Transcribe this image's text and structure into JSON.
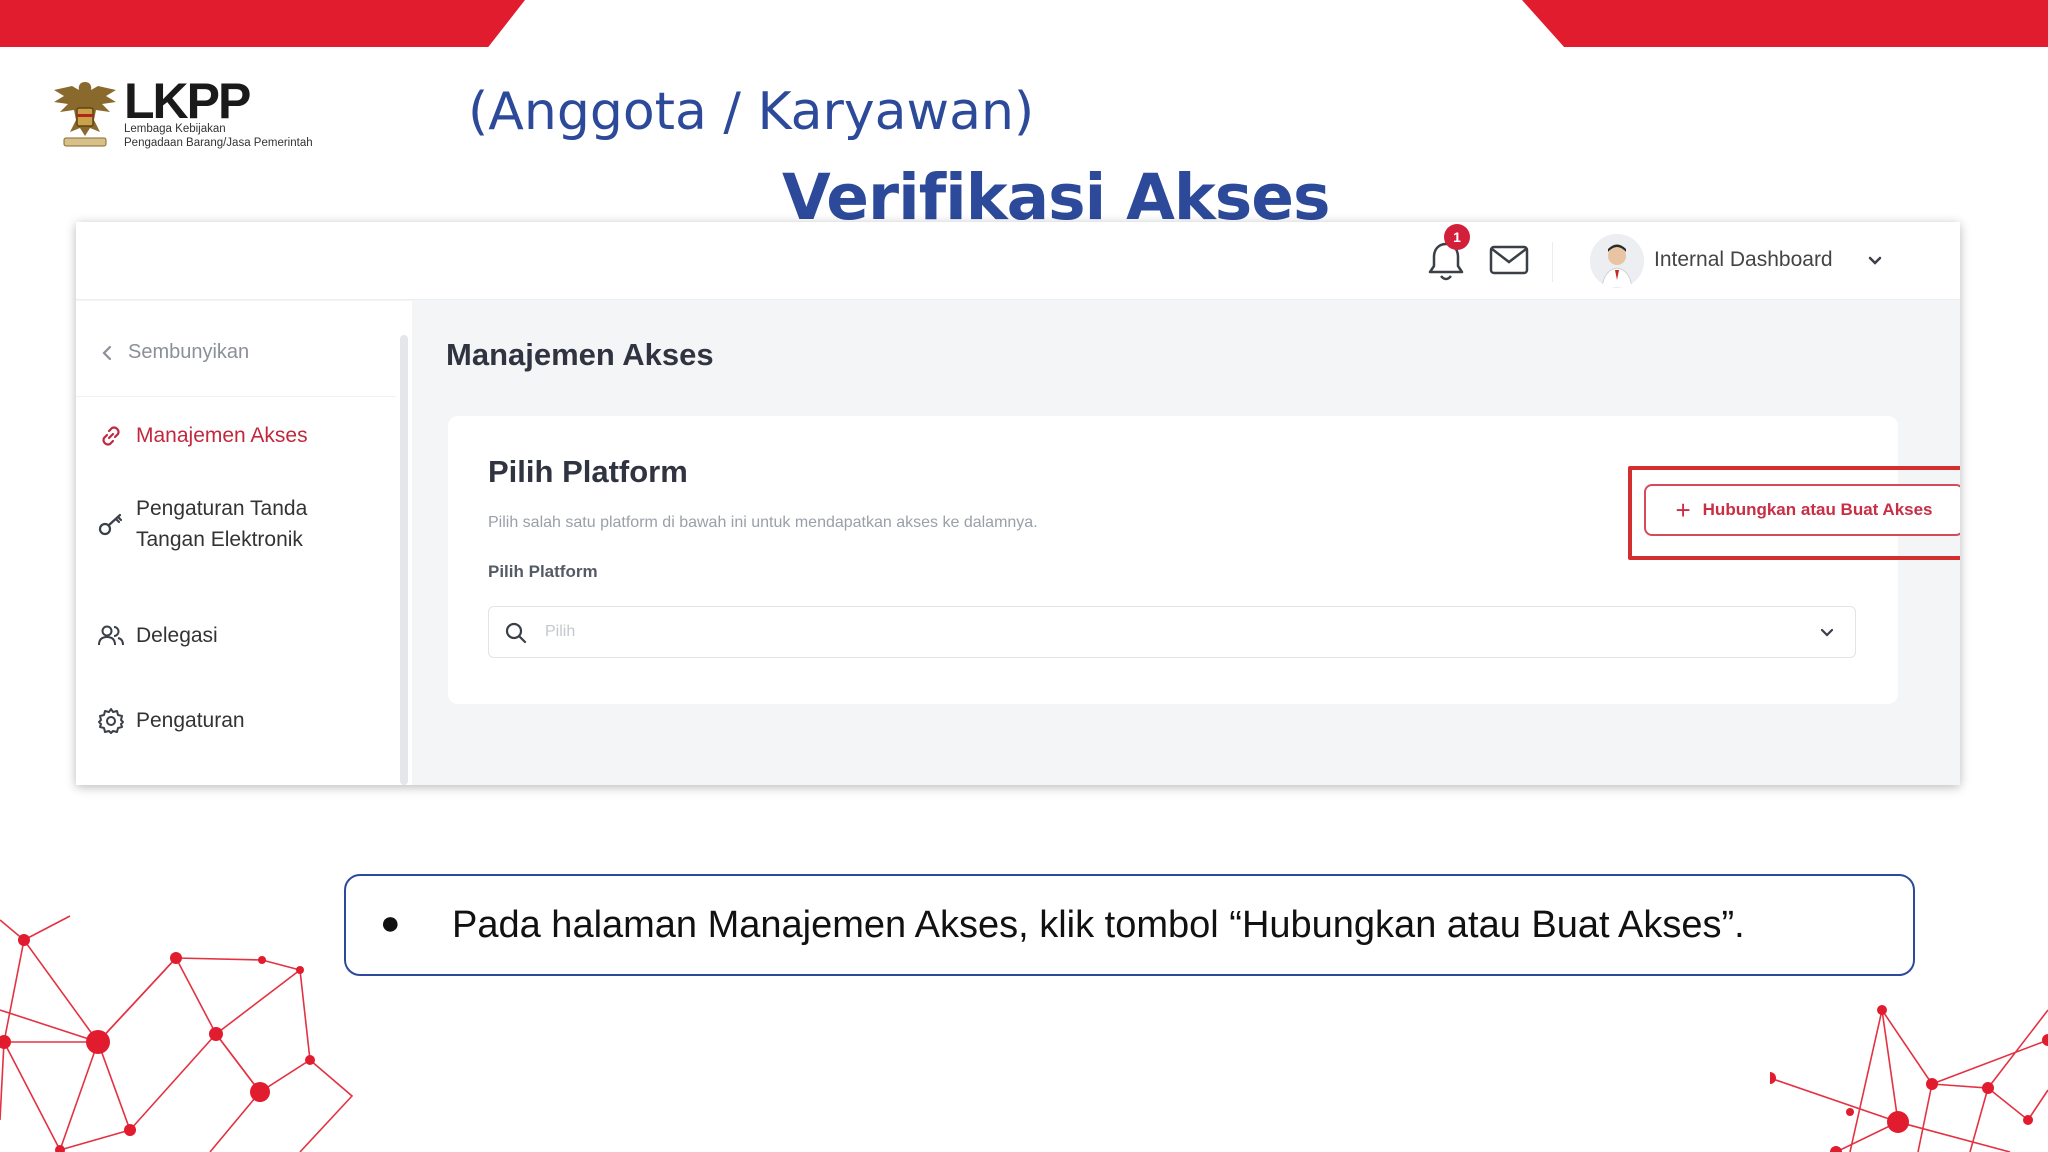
{
  "slide": {
    "title": "Verifikasi Akses",
    "subtitle": "(Anggota / Karyawan)",
    "logo": {
      "name": "LKPP",
      "line1": "Lembaga Kebijakan",
      "line2": "Pengadaan Barang/Jasa Pemerintah"
    },
    "brand_red": "#e01c2e",
    "title_blue": "#2d4a9a"
  },
  "app": {
    "header": {
      "notification_count": "1",
      "user_name": "Internal Dashboard",
      "icons": [
        "bell-icon",
        "mail-icon",
        "avatar",
        "chevron-down-icon"
      ]
    },
    "sidebar": {
      "hide_label": "Sembunyikan",
      "items": [
        {
          "label": "Manajemen Akses",
          "icon": "link-icon",
          "active": true
        },
        {
          "label_line1": "Pengaturan Tanda",
          "label_line2": "Tangan Elektronik",
          "icon": "key-icon"
        },
        {
          "label": "Delegasi",
          "icon": "users-icon"
        },
        {
          "label": "Pengaturan",
          "icon": "gear-icon"
        }
      ]
    },
    "main": {
      "page_title": "Manajemen Akses",
      "card": {
        "title": "Pilih Platform",
        "description": "Pilih salah satu platform di bawah ini untuk mendapatkan akses ke dalamnya.",
        "field_label": "Pilih Platform",
        "select_placeholder": "Pilih",
        "connect_button": "Hubungkan atau Buat Akses"
      }
    }
  },
  "callout": {
    "bullet": "●",
    "text": "Pada halaman Manajemen Akses, klik tombol “Hubungkan atau Buat Akses”."
  }
}
